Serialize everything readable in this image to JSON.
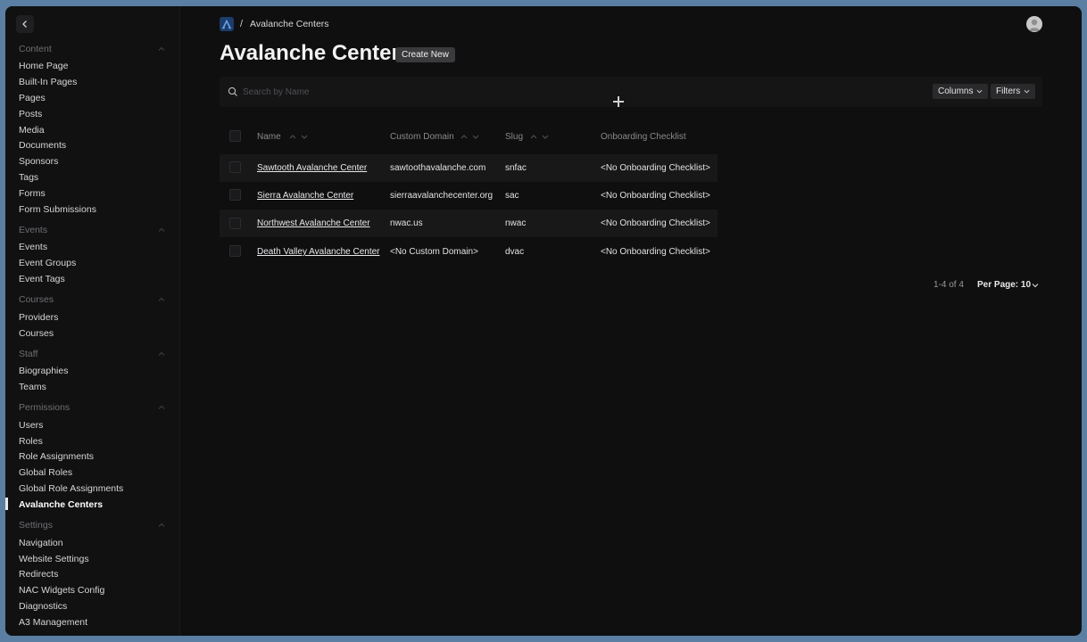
{
  "sidebar": {
    "groups": [
      {
        "title": "Content",
        "items": [
          "Home Page",
          "Built-In Pages",
          "Pages",
          "Posts",
          "Media",
          "Documents",
          "Sponsors",
          "Tags",
          "Forms",
          "Form Submissions"
        ]
      },
      {
        "title": "Events",
        "items": [
          "Events",
          "Event Groups",
          "Event Tags"
        ]
      },
      {
        "title": "Courses",
        "items": [
          "Providers",
          "Courses"
        ]
      },
      {
        "title": "Staff",
        "items": [
          "Biographies",
          "Teams"
        ]
      },
      {
        "title": "Permissions",
        "items": [
          "Users",
          "Roles",
          "Role Assignments",
          "Global Roles",
          "Global Role Assignments",
          "Avalanche Centers"
        ]
      },
      {
        "title": "Settings",
        "items": [
          "Navigation",
          "Website Settings",
          "Redirects",
          "NAC Widgets Config",
          "Diagnostics",
          "A3 Management"
        ]
      }
    ],
    "active_item": "Avalanche Centers"
  },
  "breadcrumb": {
    "separator": "/",
    "current": "Avalanche Centers"
  },
  "page": {
    "title": "Avalanche Centers",
    "create_label": "Create New"
  },
  "search": {
    "placeholder": "Search by Name",
    "value": ""
  },
  "toolbar": {
    "columns_label": "Columns",
    "filters_label": "Filters"
  },
  "table": {
    "columns": [
      "Name",
      "Custom Domain",
      "Slug",
      "Onboarding Checklist"
    ],
    "rows": [
      {
        "name": "Sawtooth Avalanche Center",
        "domain": "sawtoothavalanche.com",
        "slug": "snfac",
        "checklist": "<No Onboarding Checklist>"
      },
      {
        "name": "Sierra Avalanche Center",
        "domain": "sierraavalanchecenter.org",
        "slug": "sac",
        "checklist": "<No Onboarding Checklist>"
      },
      {
        "name": "Northwest Avalanche Center",
        "domain": "nwac.us",
        "slug": "nwac",
        "checklist": "<No Onboarding Checklist>"
      },
      {
        "name": "Death Valley Avalanche Center",
        "domain": "<No Custom Domain>",
        "slug": "dvac",
        "checklist": "<No Onboarding Checklist>"
      }
    ]
  },
  "pagination": {
    "range": "1-4 of 4",
    "per_page_label": "Per Page: 10"
  }
}
